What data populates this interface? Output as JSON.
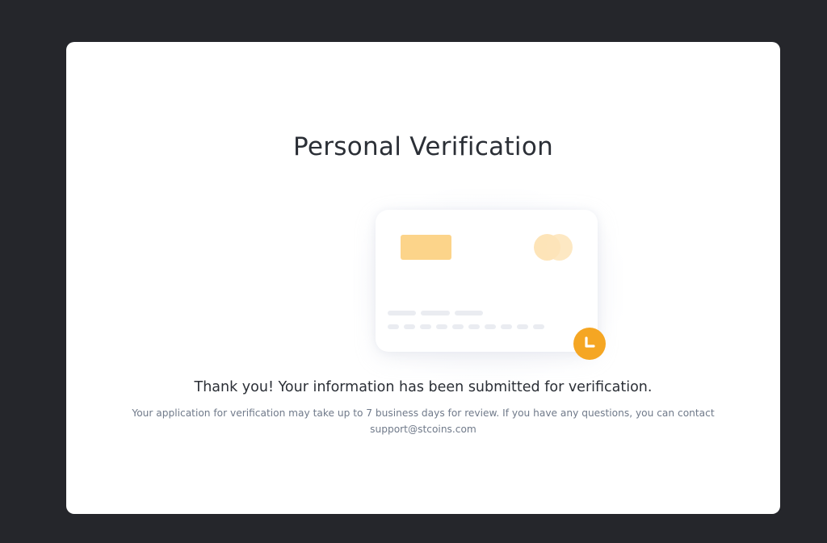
{
  "modal": {
    "title": "Personal Verification",
    "message": "Thank you! Your information has been submitted for verification.",
    "details": "Your application for verification may take up to 7 business days for review. If you have any questions, you can contact",
    "support_email": "support@stcoins.com"
  },
  "illustration": {
    "card_icon": "credit-card-icon",
    "badge_icon": "clock-icon",
    "colors": {
      "chip": "#fcd48a",
      "card_logo": "#fde4b8",
      "badge": "#f5a623",
      "placeholder_lines": "#eaecf1"
    }
  },
  "colors": {
    "background": "#25262b",
    "modal_background": "#ffffff",
    "title_text": "#2b2f36",
    "secondary_text": "#707a8a"
  }
}
